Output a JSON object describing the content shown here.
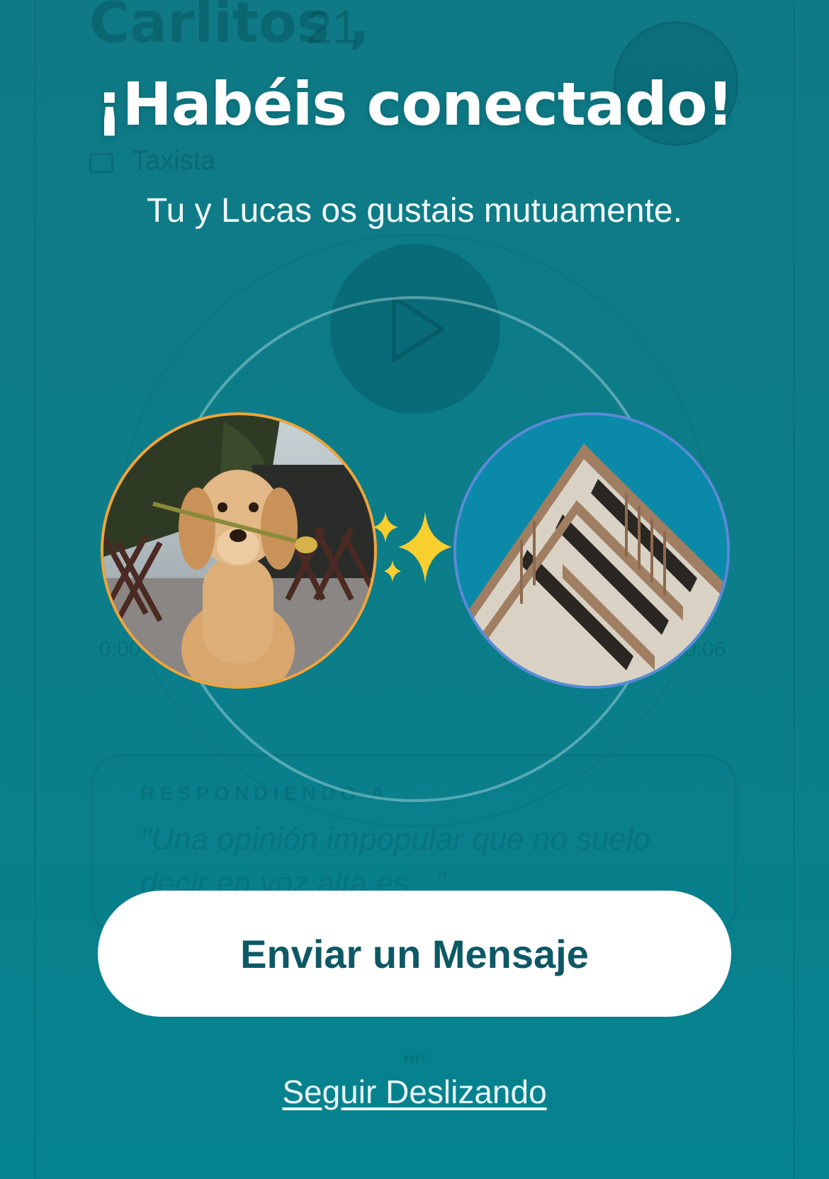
{
  "background_profile": {
    "name": "Carlitos ,",
    "age": "21",
    "job": "Taxista",
    "time_start": "0:00",
    "time_end": "0:06",
    "answer_label": "RESPONDIENDO A",
    "answer_prompt": "\"Una opinión impopular que no suelo decir en voz alta es...\"",
    "answer_quote": "\"\""
  },
  "match": {
    "title": "¡Habéis conectado!",
    "subtitle": "Tu y Lucas os gustais mutuamente.",
    "left_photo_icon": "dog-with-flower-photo",
    "right_photo_icon": "building-photo",
    "sparkles_icon": "sparkles-icon",
    "left_ring_color": "#f2a43a",
    "right_ring_color": "#5a8ad8"
  },
  "actions": {
    "send_message": "Enviar un Mensaje",
    "keep_swiping": "Seguir Deslizando"
  },
  "colors": {
    "background": "#0b7e8a",
    "button_text": "#0e5865",
    "button_bg": "#ffffff"
  }
}
